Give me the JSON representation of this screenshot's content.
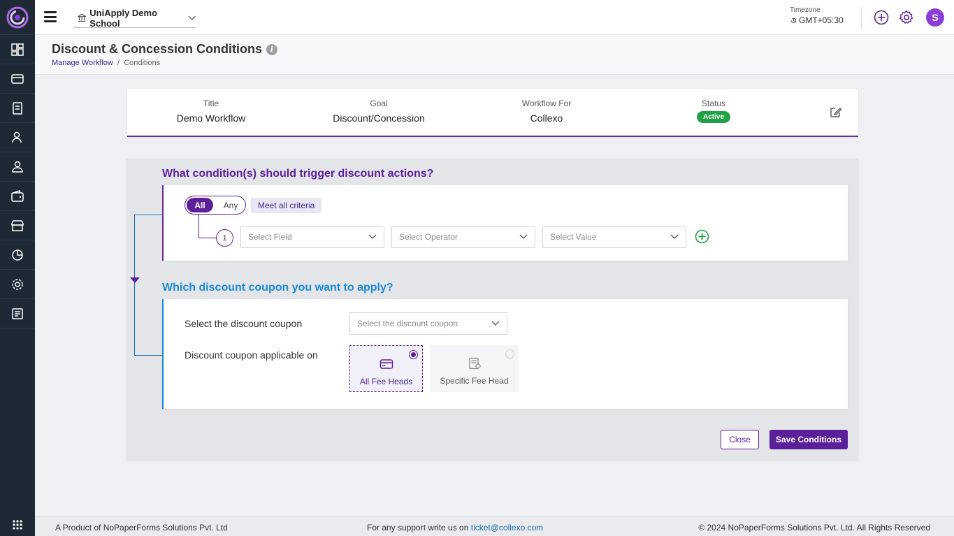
{
  "topbar": {
    "school_name": "UniApply Demo School",
    "timezone_label": "Timezone",
    "timezone_value": "GMT+05:30",
    "avatar_initial": "S"
  },
  "header": {
    "title": "Discount & Concession Conditions",
    "breadcrumb_link": "Manage Workflow",
    "breadcrumb_current": "Conditions"
  },
  "summary": {
    "title_label": "Title",
    "title_value": "Demo Workflow",
    "goal_label": "Goal",
    "goal_value": "Discount/Concession",
    "workflow_for_label": "Workflow For",
    "workflow_for_value": "Collexo",
    "status_label": "Status",
    "status_value": "Active"
  },
  "conditions": {
    "question": "What condition(s) should trigger discount actions?",
    "toggle_all": "All",
    "toggle_any": "Any",
    "criteria_text": "Meet all criteria",
    "row_number": "1",
    "field_placeholder": "Select Field",
    "operator_placeholder": "Select Operator",
    "value_placeholder": "Select Value"
  },
  "coupon": {
    "question": "Which discount coupon you want to apply?",
    "select_label": "Select the discount coupon",
    "select_placeholder": "Select the discount coupon",
    "applicable_label": "Discount coupon applicable on",
    "option_all": "All Fee Heads",
    "option_specific": "Specific Fee Head"
  },
  "actions": {
    "close": "Close",
    "save": "Save Conditions"
  },
  "footer": {
    "product": "A Product of  NoPaperForms Solutions Pvt. Ltd",
    "support_text": "For any support write us on ",
    "support_email": "ticket@collexo.com",
    "copyright": "© 2024 NoPaperForms Solutions Pvt. Ltd. All Rights Reserved"
  },
  "colors": {
    "primary": "#5c1f9a",
    "accent_blue": "#1b8ad8",
    "sidebar_bg": "#1d2a35",
    "success": "#22a247"
  }
}
